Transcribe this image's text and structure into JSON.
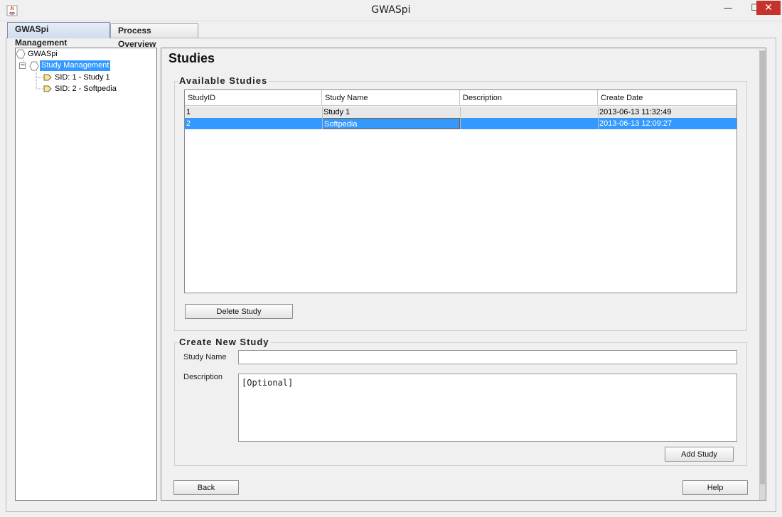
{
  "window": {
    "title": "GWASpi",
    "minimize": "—",
    "maximize": "☐",
    "close": "✕"
  },
  "tabs": [
    {
      "label": "GWASpi Management",
      "active": true
    },
    {
      "label": "Process Overview",
      "active": false
    }
  ],
  "tree": {
    "root": "GWASpi",
    "selected": "Study Management",
    "children": [
      "SID: 1 - Study 1",
      "SID: 2 - Softpedia"
    ],
    "expander": "−"
  },
  "page_title": "Studies",
  "available": {
    "title": "Available Studies",
    "columns": [
      "StudyID",
      "Study Name",
      "Description",
      "Create Date"
    ],
    "rows": [
      {
        "id": "1",
        "name": "Study 1",
        "description": "",
        "date": "2013-06-13 11:32:49"
      },
      {
        "id": "2",
        "name": "Softpedia",
        "description": "",
        "date": "2013-06-13 12:09:27",
        "selected": true
      }
    ],
    "delete_label": "Delete Study"
  },
  "create": {
    "title": "Create New Study",
    "name_label": "Study Name",
    "name_value": "",
    "desc_label": "Description",
    "desc_value": "[Optional]",
    "add_label": "Add Study"
  },
  "footer": {
    "back_label": "Back",
    "help_label": "Help"
  },
  "colors": {
    "selection": "#3399ff",
    "close": "#c7312c"
  }
}
